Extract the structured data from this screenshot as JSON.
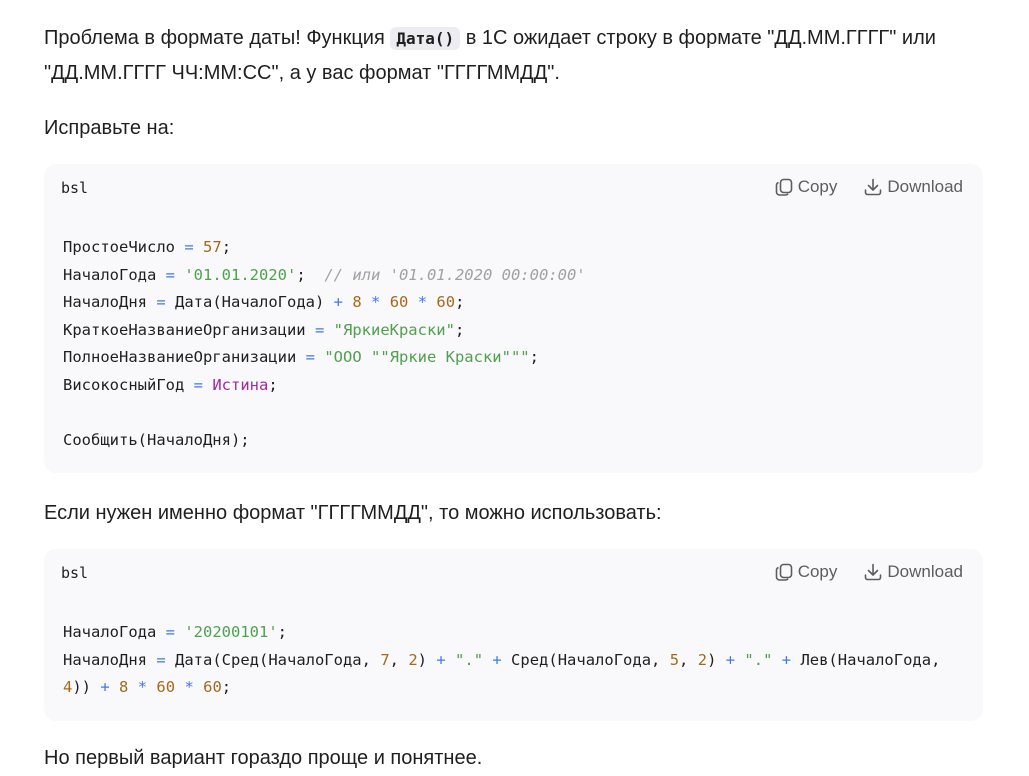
{
  "para1": {
    "before": "Проблема в формате даты! Функция ",
    "code": "Дата()",
    "after": " в 1С ожидает строку в формате \"ДД.ММ.ГГГГ\" или \"ДД.ММ.ГГГГ ЧЧ:ММ:СС\", а у вас формат \"ГГГГММДД\"."
  },
  "para2": "Исправьте на:",
  "para3": "Если нужен именно формат \"ГГГГММДД\", то можно использовать:",
  "para4": "Но первый вариант гораздо проще и понятнее.",
  "actions": {
    "copy": "Copy",
    "download": "Download"
  },
  "block1": {
    "lang": "bsl",
    "lines": [
      [
        [
          "ПростоеЧисло ",
          "plain"
        ],
        [
          "=",
          "op"
        ],
        [
          " ",
          "plain"
        ],
        [
          "57",
          "num"
        ],
        [
          ";",
          "plain"
        ]
      ],
      [
        [
          "НачалоГода ",
          "plain"
        ],
        [
          "=",
          "op"
        ],
        [
          " ",
          "plain"
        ],
        [
          "'01.01.2020'",
          "str"
        ],
        [
          ";  ",
          "plain"
        ],
        [
          "// или '01.01.2020 00:00:00'",
          "cmt"
        ]
      ],
      [
        [
          "НачалоДня ",
          "plain"
        ],
        [
          "=",
          "op"
        ],
        [
          " Дата(НачалоГода) ",
          "plain"
        ],
        [
          "+",
          "op"
        ],
        [
          " ",
          "plain"
        ],
        [
          "8",
          "num"
        ],
        [
          " ",
          "plain"
        ],
        [
          "*",
          "op"
        ],
        [
          " ",
          "plain"
        ],
        [
          "60",
          "num"
        ],
        [
          " ",
          "plain"
        ],
        [
          "*",
          "op"
        ],
        [
          " ",
          "plain"
        ],
        [
          "60",
          "num"
        ],
        [
          ";",
          "plain"
        ]
      ],
      [
        [
          "КраткоеНазваниеОрганизации ",
          "plain"
        ],
        [
          "=",
          "op"
        ],
        [
          " ",
          "plain"
        ],
        [
          "\"ЯркиеКраски\"",
          "str"
        ],
        [
          ";",
          "plain"
        ]
      ],
      [
        [
          "ПолноеНазваниеОрганизации ",
          "plain"
        ],
        [
          "=",
          "op"
        ],
        [
          " ",
          "plain"
        ],
        [
          "\"ООО \"\"Яркие Краски\"\"\"",
          "str"
        ],
        [
          ";",
          "plain"
        ]
      ],
      [
        [
          "ВисокосныйГод ",
          "plain"
        ],
        [
          "=",
          "op"
        ],
        [
          " ",
          "plain"
        ],
        [
          "Истина",
          "kw"
        ],
        [
          ";",
          "plain"
        ]
      ],
      [],
      [
        [
          "Сообщить(НачалоДня);",
          "plain"
        ]
      ]
    ]
  },
  "block2": {
    "lang": "bsl",
    "lines": [
      [
        [
          "НачалоГода ",
          "plain"
        ],
        [
          "=",
          "op"
        ],
        [
          " ",
          "plain"
        ],
        [
          "'20200101'",
          "str"
        ],
        [
          ";",
          "plain"
        ]
      ],
      [
        [
          "НачалоДня ",
          "plain"
        ],
        [
          "=",
          "op"
        ],
        [
          " Дата(Сред(НачалоГода, ",
          "plain"
        ],
        [
          "7",
          "num"
        ],
        [
          ", ",
          "plain"
        ],
        [
          "2",
          "num"
        ],
        [
          ") ",
          "plain"
        ],
        [
          "+",
          "op"
        ],
        [
          " ",
          "plain"
        ],
        [
          "\".\"",
          "str"
        ],
        [
          " ",
          "plain"
        ],
        [
          "+",
          "op"
        ],
        [
          " Сред(НачалоГода, ",
          "plain"
        ],
        [
          "5",
          "num"
        ],
        [
          ", ",
          "plain"
        ],
        [
          "2",
          "num"
        ],
        [
          ") ",
          "plain"
        ],
        [
          "+",
          "op"
        ],
        [
          " ",
          "plain"
        ],
        [
          "\".\"",
          "str"
        ],
        [
          " ",
          "plain"
        ],
        [
          "+",
          "op"
        ],
        [
          " Лев(НачалоГода,",
          "plain"
        ]
      ],
      [
        [
          "4",
          "num"
        ],
        [
          "))",
          "plain"
        ],
        [
          " ",
          "plain"
        ],
        [
          "+",
          "op"
        ],
        [
          " ",
          "plain"
        ],
        [
          "8",
          "num"
        ],
        [
          " ",
          "plain"
        ],
        [
          "*",
          "op"
        ],
        [
          " ",
          "plain"
        ],
        [
          "60",
          "num"
        ],
        [
          " ",
          "plain"
        ],
        [
          "*",
          "op"
        ],
        [
          " ",
          "plain"
        ],
        [
          "60",
          "num"
        ],
        [
          ";",
          "plain"
        ]
      ]
    ]
  }
}
